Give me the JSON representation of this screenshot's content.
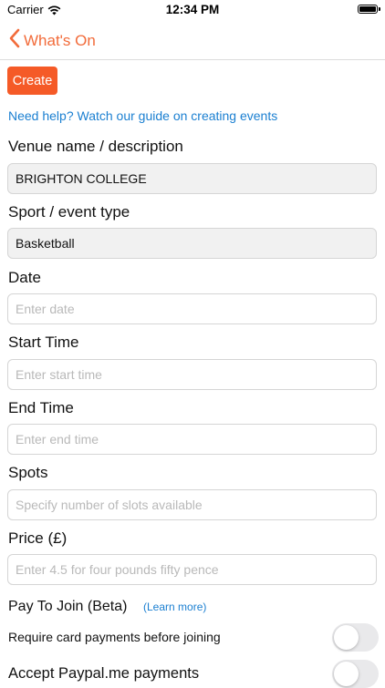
{
  "status_bar": {
    "carrier": "Carrier",
    "time": "12:34 PM"
  },
  "nav": {
    "back_label": "What's On"
  },
  "actions": {
    "create_label": "Create"
  },
  "help_link": "Need help? Watch our guide on creating events",
  "form": {
    "venue": {
      "label": "Venue name / description",
      "value": "BRIGHTON COLLEGE"
    },
    "sport": {
      "label": "Sport / event type",
      "value": "Basketball"
    },
    "date": {
      "label": "Date",
      "placeholder": "Enter date"
    },
    "start_time": {
      "label": "Start Time",
      "placeholder": "Enter start time"
    },
    "end_time": {
      "label": "End Time",
      "placeholder": "Enter end time"
    },
    "spots": {
      "label": "Spots",
      "placeholder": "Specify number of slots available"
    },
    "price": {
      "label": "Price (£)",
      "placeholder": "Enter 4.5 for four pounds fifty pence"
    }
  },
  "pay_to_join": {
    "label": "Pay To Join (Beta)",
    "learn_more": "(Learn more)",
    "require_card_label": "Require card payments before joining",
    "require_card_enabled": false,
    "paypal_label": "Accept Paypal.me payments",
    "paypal_enabled": false
  },
  "colors": {
    "accent": "#f55a27",
    "link": "#1a7fd1",
    "toggle_off": "#e9e9eb"
  }
}
